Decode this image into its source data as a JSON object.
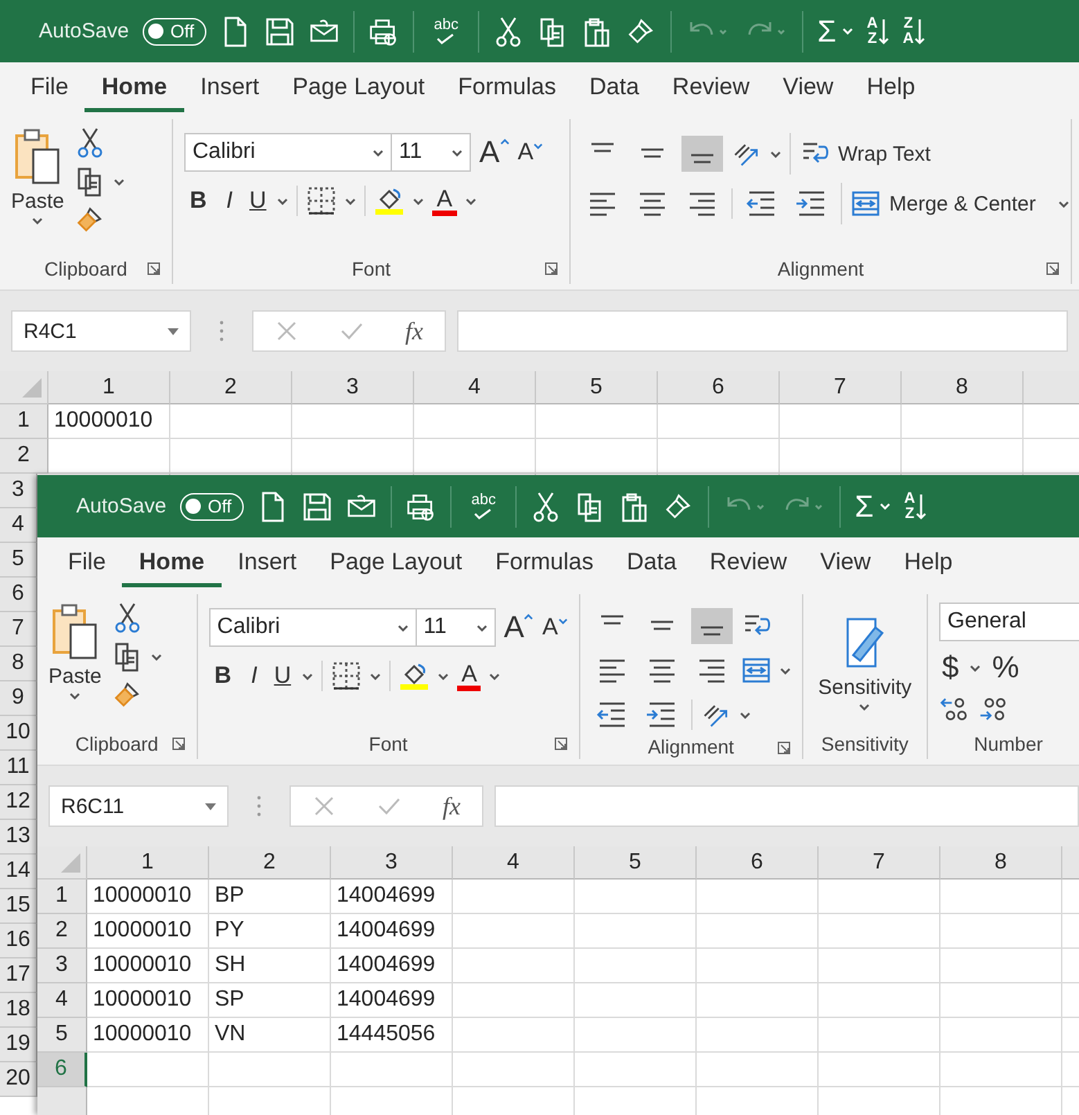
{
  "windows": [
    {
      "autosave": {
        "label": "AutoSave",
        "on": false,
        "state_text": "Off"
      },
      "spelling": "abc",
      "sum": "Σ",
      "undo_disabled": true,
      "redo_disabled": true,
      "sort_buttons": [
        {
          "top": "A",
          "bottom": "Z"
        },
        {
          "top": "Z",
          "bottom": "A"
        }
      ],
      "tabs": [
        {
          "label": "File",
          "selected": false
        },
        {
          "label": "Home",
          "selected": true
        },
        {
          "label": "Insert",
          "selected": false
        },
        {
          "label": "Page Layout",
          "selected": false
        },
        {
          "label": "Formulas",
          "selected": false
        },
        {
          "label": "Data",
          "selected": false
        },
        {
          "label": "Review",
          "selected": false
        },
        {
          "label": "View",
          "selected": false
        },
        {
          "label": "Help",
          "selected": false
        }
      ],
      "groups": [
        {
          "kind": "clipboard",
          "label": "Clipboard",
          "paste": "Paste"
        },
        {
          "kind": "font",
          "label": "Font",
          "font": "Calibri",
          "size": "11",
          "grow": "A",
          "shrink": "A",
          "bold": "B",
          "italic": "I",
          "underline": "U",
          "color_letter": "A"
        },
        {
          "kind": "alignment_wide",
          "label": "Alignment",
          "valign_selected": [
            false,
            false,
            true
          ],
          "wrap": "Wrap Text",
          "merge": "Merge & Center"
        }
      ],
      "name_box": "R4C1",
      "fx": "fx",
      "columns": [
        "1",
        "2",
        "3",
        "4",
        "5",
        "6",
        "7",
        "8"
      ],
      "rows": [
        {
          "header": "1",
          "selected": false,
          "cells": [
            "10000010"
          ]
        },
        {
          "header": "2",
          "selected": false,
          "cells": []
        },
        {
          "header": "3",
          "selected": false,
          "cells": []
        },
        {
          "header": "4",
          "selected": false,
          "cells": []
        },
        {
          "header": "5",
          "selected": false,
          "cells": []
        },
        {
          "header": "6",
          "selected": false,
          "cells": []
        },
        {
          "header": "7",
          "selected": false,
          "cells": []
        },
        {
          "header": "8",
          "selected": false,
          "cells": []
        },
        {
          "header": "9",
          "selected": false,
          "cells": []
        },
        {
          "header": "10",
          "selected": false,
          "cells": []
        },
        {
          "header": "11",
          "selected": false,
          "cells": []
        },
        {
          "header": "12",
          "selected": false,
          "cells": []
        },
        {
          "header": "13",
          "selected": false,
          "cells": []
        },
        {
          "header": "14",
          "selected": false,
          "cells": []
        },
        {
          "header": "15",
          "selected": false,
          "cells": []
        },
        {
          "header": "16",
          "selected": false,
          "cells": []
        },
        {
          "header": "17",
          "selected": false,
          "cells": []
        },
        {
          "header": "18",
          "selected": false,
          "cells": []
        },
        {
          "header": "19",
          "selected": false,
          "cells": []
        },
        {
          "header": "20",
          "selected": false,
          "cells": []
        }
      ]
    },
    {
      "autosave": {
        "label": "AutoSave",
        "on": false,
        "state_text": "Off"
      },
      "spelling": "abc",
      "sum": "Σ",
      "undo_disabled": true,
      "redo_disabled": true,
      "sort_buttons": [
        {
          "top": "A",
          "bottom": "Z"
        }
      ],
      "tabs": [
        {
          "label": "File",
          "selected": false
        },
        {
          "label": "Home",
          "selected": true
        },
        {
          "label": "Insert",
          "selected": false
        },
        {
          "label": "Page Layout",
          "selected": false
        },
        {
          "label": "Formulas",
          "selected": false
        },
        {
          "label": "Data",
          "selected": false
        },
        {
          "label": "Review",
          "selected": false
        },
        {
          "label": "View",
          "selected": false
        },
        {
          "label": "Help",
          "selected": false
        }
      ],
      "groups": [
        {
          "kind": "clipboard",
          "label": "Clipboard",
          "paste": "Paste"
        },
        {
          "kind": "font",
          "label": "Font",
          "font": "Calibri",
          "size": "11",
          "grow": "A",
          "shrink": "A",
          "bold": "B",
          "italic": "I",
          "underline": "U",
          "color_letter": "A"
        },
        {
          "kind": "alignment_compact",
          "label": "Alignment",
          "valign_selected": [
            false,
            false,
            true
          ]
        },
        {
          "kind": "sensitivity",
          "label": "Sensitivity",
          "button": "Sensitivity"
        },
        {
          "kind": "number",
          "label": "Number",
          "format": "General",
          "currency": "$",
          "percent": "%"
        }
      ],
      "name_box": "R6C11",
      "fx": "fx",
      "columns": [
        "1",
        "2",
        "3",
        "4",
        "5",
        "6",
        "7",
        "8"
      ],
      "rows": [
        {
          "header": "1",
          "selected": false,
          "cells": [
            "10000010",
            "BP",
            "14004699"
          ]
        },
        {
          "header": "2",
          "selected": false,
          "cells": [
            "10000010",
            "PY",
            "14004699"
          ]
        },
        {
          "header": "3",
          "selected": false,
          "cells": [
            "10000010",
            "SH",
            "14004699"
          ]
        },
        {
          "header": "4",
          "selected": false,
          "cells": [
            "10000010",
            "SP",
            "14004699"
          ]
        },
        {
          "header": "5",
          "selected": false,
          "cells": [
            "10000010",
            "VN",
            "14445056"
          ]
        },
        {
          "header": "6",
          "selected": true,
          "cells": []
        }
      ]
    }
  ]
}
